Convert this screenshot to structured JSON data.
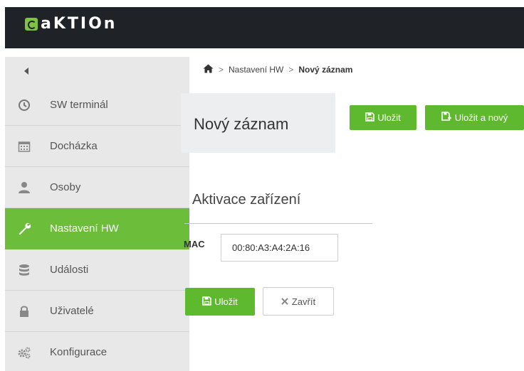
{
  "app": {
    "logo_text": "aKTIOn"
  },
  "sidebar": {
    "items": [
      {
        "label": "SW terminál",
        "icon": "clock-icon",
        "active": false
      },
      {
        "label": "Docházka",
        "icon": "calendar-icon",
        "active": false
      },
      {
        "label": "Osoby",
        "icon": "person-icon",
        "active": false
      },
      {
        "label": "Nastavení HW",
        "icon": "wrench-icon",
        "active": true
      },
      {
        "label": "Události",
        "icon": "database-icon",
        "active": false
      },
      {
        "label": "Uživatelé",
        "icon": "lock-icon",
        "active": false
      },
      {
        "label": "Konfigurace",
        "icon": "gears-icon",
        "active": false
      }
    ]
  },
  "breadcrumb": {
    "sep": ">",
    "level1": "Nastavení HW",
    "current": "Nový záznam"
  },
  "page": {
    "title": "Nový záznam"
  },
  "toolbar": {
    "save_label": "Uložit",
    "save_new_label": "Uložit a nový"
  },
  "form": {
    "section_title": "Aktivace zařízení",
    "mac_label": "MAC",
    "mac_value": "00:80:A3:A4:2A:16",
    "save_label": "Uložit",
    "close_label": "Zavřít"
  },
  "colors": {
    "accent": "#5fb92e",
    "topbar": "#1f2226",
    "sidebar": "#e8e8e8"
  }
}
